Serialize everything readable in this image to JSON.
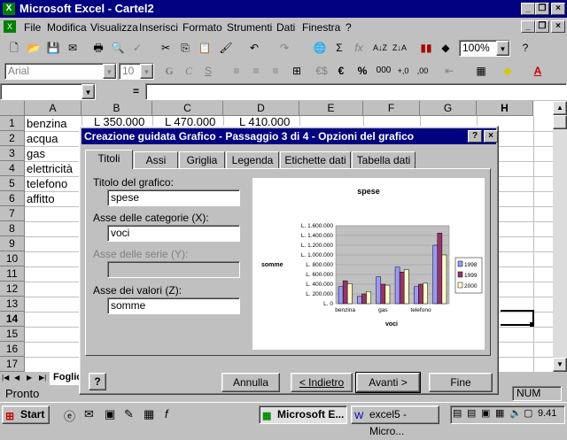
{
  "window": {
    "title": "Microsoft Excel - Cartel2"
  },
  "menu": [
    "File",
    "Modifica",
    "Visualizza",
    "Inserisci",
    "Formato",
    "Strumenti",
    "Dati",
    "Finestra",
    "?"
  ],
  "toolbar": {
    "zoom": "100%"
  },
  "format": {
    "font": "Arial",
    "size": "10"
  },
  "formula_bar": {
    "cell_ref": "",
    "eq": "="
  },
  "columns": [
    "A",
    "B",
    "C",
    "D",
    "E",
    "F",
    "G",
    "H"
  ],
  "rows": [
    "1",
    "2",
    "3",
    "4",
    "5",
    "6",
    "7",
    "8",
    "9",
    "10",
    "11",
    "12",
    "13",
    "14",
    "15",
    "16",
    "17"
  ],
  "cells": {
    "a1": "benzina",
    "a2": "acqua",
    "a3": "gas",
    "a4": "elettricità",
    "a5": "telefono",
    "a6": "affitto",
    "b1": "L 350.000",
    "c1": "L 470.000",
    "d1": "L 410.000"
  },
  "sheet_tab": "Foglio",
  "status": {
    "left": "Pronto",
    "num": "NUM"
  },
  "dialog": {
    "title": "Creazione guidata Grafico - Passaggio 3 di 4 - Opzioni del grafico",
    "help": "?",
    "close": "×",
    "tabs": [
      "Titoli",
      "Assi",
      "Griglia",
      "Legenda",
      "Etichette dati",
      "Tabella dati"
    ],
    "fields": {
      "chart_title_label": "Titolo del grafico:",
      "chart_title_value": "spese",
      "cat_axis_label": "Asse delle categorie (X):",
      "cat_axis_value": "voci",
      "series_axis_label": "Asse delle serie (Y):",
      "series_axis_value": "",
      "value_axis_label": "Asse dei valori (Z):",
      "value_axis_value": "somme"
    },
    "buttons": {
      "cancel": "Annulla",
      "back": "< Indietro",
      "next": "Avanti >",
      "finish": "Fine"
    }
  },
  "chart_data": {
    "type": "bar",
    "title": "spese",
    "xlabel": "voci",
    "ylabel": "somme",
    "categories": [
      "benzina",
      "acqua",
      "gas",
      "elettricità",
      "telefono",
      "affitto"
    ],
    "x_tick_labels": [
      "benzina",
      "gas",
      "telefono"
    ],
    "y_ticks": [
      "L. 1.600.000",
      "L. 1.400.000",
      "L. 1.200.000",
      "L. 1.000.000",
      "L. 800.000",
      "L. 600.000",
      "L. 400.000",
      "L. 200.000",
      "L. 0"
    ],
    "ylim": [
      0,
      1600000
    ],
    "series": [
      {
        "name": "1998",
        "color": "#9999ff",
        "values": [
          350000,
          150000,
          550000,
          750000,
          350000,
          1200000
        ]
      },
      {
        "name": "1999",
        "color": "#993366",
        "values": [
          470000,
          200000,
          400000,
          650000,
          400000,
          1450000
        ]
      },
      {
        "name": "2000",
        "color": "#ffffcc",
        "values": [
          410000,
          250000,
          380000,
          700000,
          420000,
          1000000
        ]
      }
    ],
    "legend": "right"
  },
  "taskbar": {
    "start": "Start",
    "tasks": [
      "Microsoft E...",
      "excel5 - Micro..."
    ],
    "clock": "9.41"
  }
}
